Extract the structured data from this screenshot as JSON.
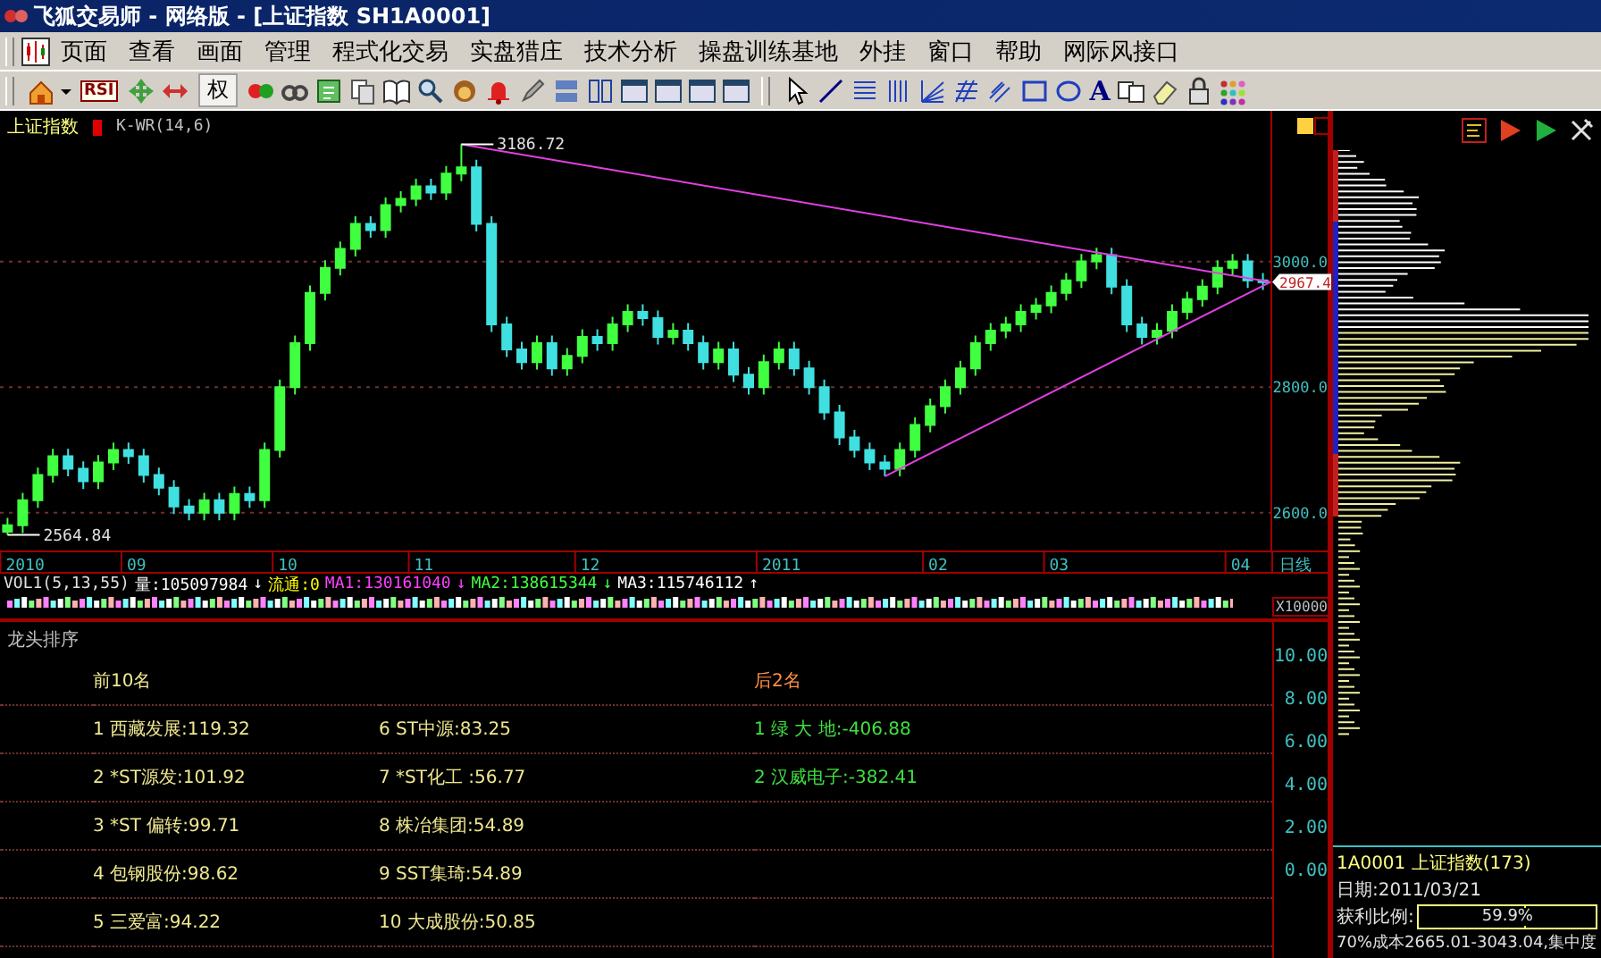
{
  "window": {
    "title": "飞狐交易师 - 网络版 - [上证指数 SH1A0001]"
  },
  "menu": [
    "页面",
    "查看",
    "画面",
    "管理",
    "程式化交易",
    "实盘猎庄",
    "技术分析",
    "操盘训练基地",
    "外挂",
    "窗口",
    "帮助",
    "网际风接口"
  ],
  "toolbar": {
    "rsi_label": "RSI",
    "rights_label": "权",
    "text_tool_label": "A"
  },
  "chart": {
    "date_labels": [
      "2010",
      "09",
      "10",
      "11",
      "12",
      "2011",
      "02",
      "03",
      "04"
    ],
    "title": "上证指数",
    "indicator": "K-WR(14,6)",
    "high_label": "3186.72",
    "low_label": "2564.84",
    "current_price": "2967.4",
    "period": "日线",
    "chart_data": {
      "type": "candlestick",
      "categories": [
        null,
        null,
        null,
        null,
        null,
        null,
        null,
        null,
        null,
        null,
        null,
        null,
        null,
        null,
        null,
        null,
        null,
        null,
        null,
        null,
        null,
        null,
        null,
        null,
        null,
        null,
        null,
        null,
        null,
        null,
        null,
        null,
        null,
        null,
        null,
        null,
        null,
        null,
        null,
        null,
        null,
        null,
        null,
        null,
        null,
        null,
        null,
        null,
        null,
        null,
        null,
        null,
        null,
        null,
        null,
        null,
        null,
        null,
        null,
        null,
        null,
        null,
        null,
        null,
        null,
        null,
        null,
        null,
        null,
        null,
        null,
        null,
        null,
        null,
        null,
        null,
        null,
        null,
        null,
        null,
        null,
        null,
        null,
        null
      ],
      "ohlc": [
        [
          2570,
          2592,
          2564.84,
          2580
        ],
        [
          2580,
          2632,
          2568,
          2620
        ],
        [
          2620,
          2672,
          2608,
          2660
        ],
        [
          2660,
          2702,
          2648,
          2690
        ],
        [
          2690,
          2702,
          2658,
          2670
        ],
        [
          2670,
          2682,
          2638,
          2650
        ],
        [
          2650,
          2692,
          2638,
          2680
        ],
        [
          2680,
          2712,
          2668,
          2700
        ],
        [
          2700,
          2712,
          2678,
          2690
        ],
        [
          2690,
          2702,
          2648,
          2660
        ],
        [
          2660,
          2672,
          2628,
          2640
        ],
        [
          2640,
          2652,
          2598,
          2610
        ],
        [
          2610,
          2622,
          2588,
          2600
        ],
        [
          2600,
          2632,
          2588,
          2620
        ],
        [
          2620,
          2632,
          2588,
          2600
        ],
        [
          2600,
          2642,
          2588,
          2630
        ],
        [
          2630,
          2642,
          2608,
          2620
        ],
        [
          2620,
          2712,
          2608,
          2700
        ],
        [
          2700,
          2812,
          2688,
          2800
        ],
        [
          2800,
          2882,
          2788,
          2870
        ],
        [
          2870,
          2962,
          2858,
          2950
        ],
        [
          2950,
          3002,
          2938,
          2990
        ],
        [
          2990,
          3032,
          2978,
          3020
        ],
        [
          3020,
          3072,
          3008,
          3060
        ],
        [
          3060,
          3072,
          3038,
          3050
        ],
        [
          3050,
          3102,
          3038,
          3090
        ],
        [
          3090,
          3112,
          3078,
          3100
        ],
        [
          3100,
          3132,
          3088,
          3120
        ],
        [
          3120,
          3132,
          3098,
          3110
        ],
        [
          3110,
          3152,
          3098,
          3140
        ],
        [
          3140,
          3186.72,
          3128,
          3150
        ],
        [
          3150,
          3162,
          3048,
          3060
        ],
        [
          3060,
          3072,
          2888,
          2900
        ],
        [
          2900,
          2912,
          2848,
          2860
        ],
        [
          2860,
          2872,
          2828,
          2840
        ],
        [
          2840,
          2882,
          2828,
          2870
        ],
        [
          2870,
          2882,
          2818,
          2830
        ],
        [
          2830,
          2862,
          2818,
          2850
        ],
        [
          2850,
          2892,
          2838,
          2880
        ],
        [
          2880,
          2892,
          2858,
          2870
        ],
        [
          2870,
          2912,
          2858,
          2900
        ],
        [
          2900,
          2932,
          2888,
          2920
        ],
        [
          2920,
          2932,
          2898,
          2910
        ],
        [
          2910,
          2922,
          2868,
          2880
        ],
        [
          2880,
          2902,
          2868,
          2890
        ],
        [
          2890,
          2902,
          2858,
          2870
        ],
        [
          2870,
          2882,
          2828,
          2840
        ],
        [
          2840,
          2872,
          2828,
          2860
        ],
        [
          2860,
          2872,
          2808,
          2820
        ],
        [
          2820,
          2832,
          2788,
          2800
        ],
        [
          2800,
          2852,
          2788,
          2840
        ],
        [
          2840,
          2872,
          2828,
          2860
        ],
        [
          2860,
          2872,
          2818,
          2830
        ],
        [
          2830,
          2842,
          2788,
          2800
        ],
        [
          2800,
          2812,
          2748,
          2760
        ],
        [
          2760,
          2772,
          2708,
          2720
        ],
        [
          2720,
          2732,
          2688,
          2700
        ],
        [
          2700,
          2712,
          2668,
          2680
        ],
        [
          2680,
          2692,
          2658,
          2670
        ],
        [
          2670,
          2712,
          2658,
          2700
        ],
        [
          2700,
          2752,
          2688,
          2740
        ],
        [
          2740,
          2782,
          2728,
          2770
        ],
        [
          2770,
          2812,
          2758,
          2800
        ],
        [
          2800,
          2842,
          2788,
          2830
        ],
        [
          2830,
          2882,
          2818,
          2870
        ],
        [
          2870,
          2902,
          2858,
          2890
        ],
        [
          2890,
          2912,
          2878,
          2900
        ],
        [
          2900,
          2932,
          2888,
          2920
        ],
        [
          2920,
          2942,
          2908,
          2930
        ],
        [
          2930,
          2962,
          2918,
          2950
        ],
        [
          2950,
          2982,
          2938,
          2970
        ],
        [
          2970,
          3012,
          2958,
          3000
        ],
        [
          3000,
          3022,
          2988,
          3010
        ],
        [
          3010,
          3022,
          2948,
          2960
        ],
        [
          2960,
          2972,
          2888,
          2900
        ],
        [
          2900,
          2912,
          2868,
          2880
        ],
        [
          2880,
          2902,
          2868,
          2890
        ],
        [
          2890,
          2932,
          2878,
          2920
        ],
        [
          2920,
          2952,
          2908,
          2940
        ],
        [
          2940,
          2972,
          2928,
          2960
        ],
        [
          2960,
          3002,
          2948,
          2990
        ],
        [
          2990,
          3012,
          2978,
          3000
        ],
        [
          3000,
          3012,
          2958,
          2970
        ],
        [
          2970,
          2982,
          2955,
          2967.4
        ]
      ],
      "grid": true,
      "ylim": [
        2540,
        3240
      ],
      "yticks": [
        {
          "value": 3000,
          "label": "3000.0"
        },
        {
          "value": 2800,
          "label": "2800.0"
        },
        {
          "value": 2600,
          "label": "2600.0"
        }
      ]
    }
  },
  "volume": {
    "label": "VOL1(5,13,55)",
    "scale": "X10000",
    "items": [
      {
        "text": "量:105097984",
        "arrow": "↓",
        "color": "#ffffff"
      },
      {
        "text": "流通:0",
        "color": "#ffff00"
      },
      {
        "text": "MA1:130161040",
        "arrow": "↓",
        "color": "#ff40ff"
      },
      {
        "text": "MA2:138615344",
        "arrow": "↓",
        "color": "#40ff40"
      },
      {
        "text": "MA3:115746112",
        "arrow": "↑",
        "color": "#ffffff"
      }
    ]
  },
  "ranking": {
    "title": "龙头排序",
    "top_heading": "前10名",
    "bottom_heading": "后2名",
    "top": [
      "1 西藏发展:119.32",
      "2 *ST源发:101.92",
      "3 *ST 偏转:99.71",
      "4 包钢股份:98.62",
      "5 三爱富:94.22",
      "6 ST中源:83.25",
      "7 *ST化工 :56.77",
      "8 株冶集团:54.89",
      "9 SST集琦:54.89",
      "10 大成股份:50.85"
    ],
    "bottom": [
      "1 绿 大 地:-406.88",
      "2 汉威电子:-382.41"
    ],
    "y_ticks": [
      "10.00",
      "8.00",
      "6.00",
      "4.00",
      "2.00",
      "0.00"
    ]
  },
  "info": {
    "code_name": "1A0001 上证指数(173)",
    "date": "日期:2011/03/21",
    "profit_label": "获利比例:",
    "profit_value": "59.9%",
    "level": 0.599,
    "cost_line": "70%成本2665.01-3043.04,集中度"
  }
}
